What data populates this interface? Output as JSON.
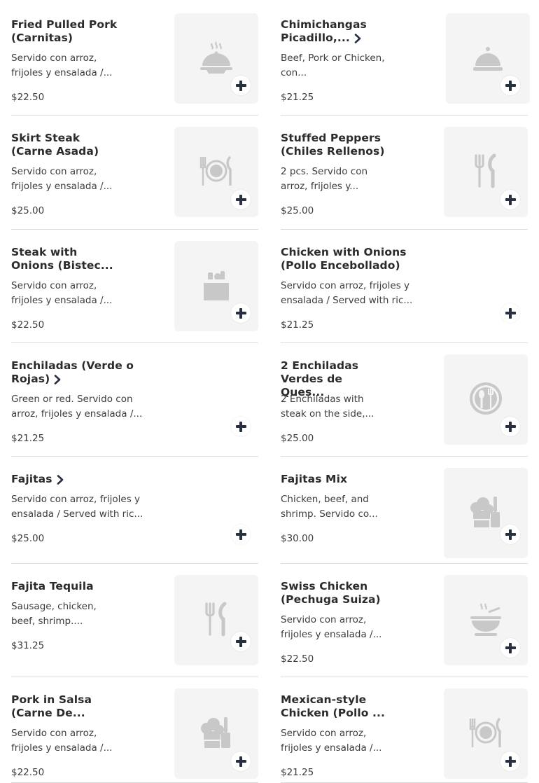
{
  "items": [
    {
      "name": "Fried Pulled Pork (Carnitas)",
      "desc": "Servido con arroz, frijoles y ensalada /...",
      "price": "$22.50",
      "icon": "cloche-steam-icon"
    },
    {
      "name": "Chimichangas Picadillo,...",
      "desc": "Beef, Pork or Chicken, con...",
      "price": "$21.25",
      "icon": "cloche-icon"
    },
    {
      "name": "Skirt Steak (Carne Asada)",
      "desc": "Servido con arroz, frijoles y ensalada /...",
      "price": "$25.00",
      "icon": "plate-cutlery-icon"
    },
    {
      "name": "Stuffed Peppers (Chiles Rellenos)",
      "desc": "2 pcs. Servido con arroz, frijoles y...",
      "price": "$25.00",
      "icon": "fork-knife-icon"
    },
    {
      "name": "Steak with Onions (Bistec...",
      "desc": "Servido con arroz, frijoles y ensalada /...",
      "price": "$22.50",
      "icon": "grocery-bag-icon"
    },
    {
      "name": "Chicken with Onions (Pollo Encebollado)",
      "desc": "Servido con arroz, frijoles y ensalada / Served with ric...",
      "price": "$21.25",
      "icon": ""
    },
    {
      "name": "Enchiladas (Verde o Rojas)",
      "desc": "Green or red. Servido con arroz, frijoles y ensalada /...",
      "price": "$21.25",
      "icon": ""
    },
    {
      "name": "2 Enchiladas Verdes de Ques...",
      "desc": "2 Enchiladas with steak on the side,...",
      "price": "$25.00",
      "icon": "spoon-fork-plate-icon"
    },
    {
      "name": "Fajitas",
      "desc": "Servido con arroz, frijoles y ensalada / Served with ric...",
      "price": "$25.00",
      "icon": ""
    },
    {
      "name": "Fajitas Mix",
      "desc": "Chicken, beef, and shrimp. Servido co...",
      "price": "$30.00",
      "icon": "chef-hat-utensil-icon"
    },
    {
      "name": "Fajita Tequila",
      "desc": "Sausage, chicken, beef, shrimp....",
      "price": "$31.25",
      "icon": "fork-knife-icon"
    },
    {
      "name": "Swiss Chicken (Pechuga Suiza)",
      "desc": "Servido con arroz, frijoles y ensalada /...",
      "price": "$22.50",
      "icon": "soup-bowl-icon"
    },
    {
      "name": "Pork in Salsa (Carne De...",
      "desc": "Servido con arroz, frijoles y ensalada /...",
      "price": "$22.50",
      "icon": "chef-hat-utensil-icon"
    },
    {
      "name": "Mexican-style Chicken (Pollo ...",
      "desc": "Servido con arroz, frijoles y ensalada /...",
      "price": "$21.25",
      "icon": "plate-cutlery-icon"
    }
  ],
  "colors": {
    "accent": "#27303f",
    "thumb_bg": "#f4f4f4",
    "icon_gray": "#c8c8c8",
    "divider": "#dcdcdc"
  }
}
